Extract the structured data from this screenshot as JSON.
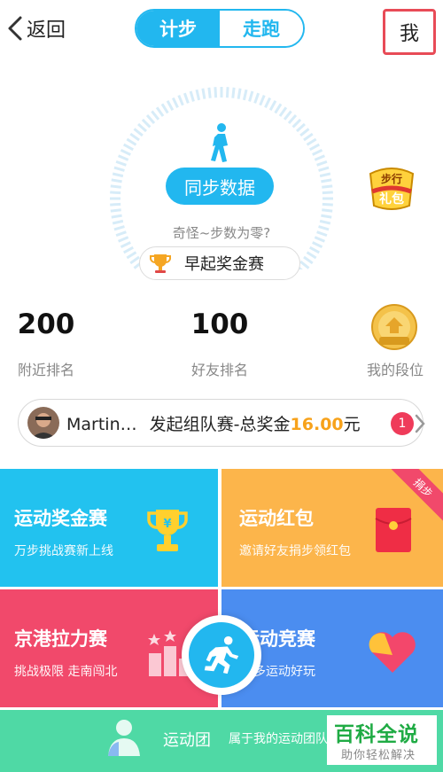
{
  "topbar": {
    "back_label": "返回",
    "tabs": [
      {
        "label": "计步",
        "active": true
      },
      {
        "label": "走跑",
        "active": false
      }
    ],
    "me_label": "我"
  },
  "step_panel": {
    "sync_label": "同步数据",
    "zero_message": "奇怪~步数为零?",
    "morning_race_label": "早起奖金赛",
    "gift_badge_text": "步行礼包",
    "accent_color": "#22b7ef"
  },
  "stats": {
    "nearby": {
      "value": "200",
      "label": "附近排名"
    },
    "friends": {
      "value": "100",
      "label": "好友排名"
    },
    "level": {
      "label": "我的段位"
    }
  },
  "team_banner": {
    "name": "Martin…",
    "text": "发起组队赛-总奖金",
    "amount": "16.00",
    "unit": "元",
    "badge_count": "1"
  },
  "tiles": [
    {
      "title": "运动奖金赛",
      "subtitle": "万步挑战赛新上线",
      "color": "#22c2ef",
      "icon": "trophy-icon"
    },
    {
      "title": "运动红包",
      "subtitle": "邀请好友捐步领红包",
      "color": "#fcb54b",
      "icon": "red-envelope-icon",
      "ribbon": "捐步"
    },
    {
      "title": "京港拉力赛",
      "subtitle": "挑战极限 走南闯北",
      "color": "#f1496b",
      "icon": "podium-icon"
    },
    {
      "title": "运动竞赛",
      "subtitle": "更多运动好玩",
      "color": "#4b8df0",
      "icon": "heart-icon"
    }
  ],
  "club": {
    "title": "运动团",
    "subtitle": "属于我的运动团队",
    "color": "#4fd9a5"
  },
  "watermark": {
    "main": "百科全说",
    "sub": "助你轻松解决"
  }
}
